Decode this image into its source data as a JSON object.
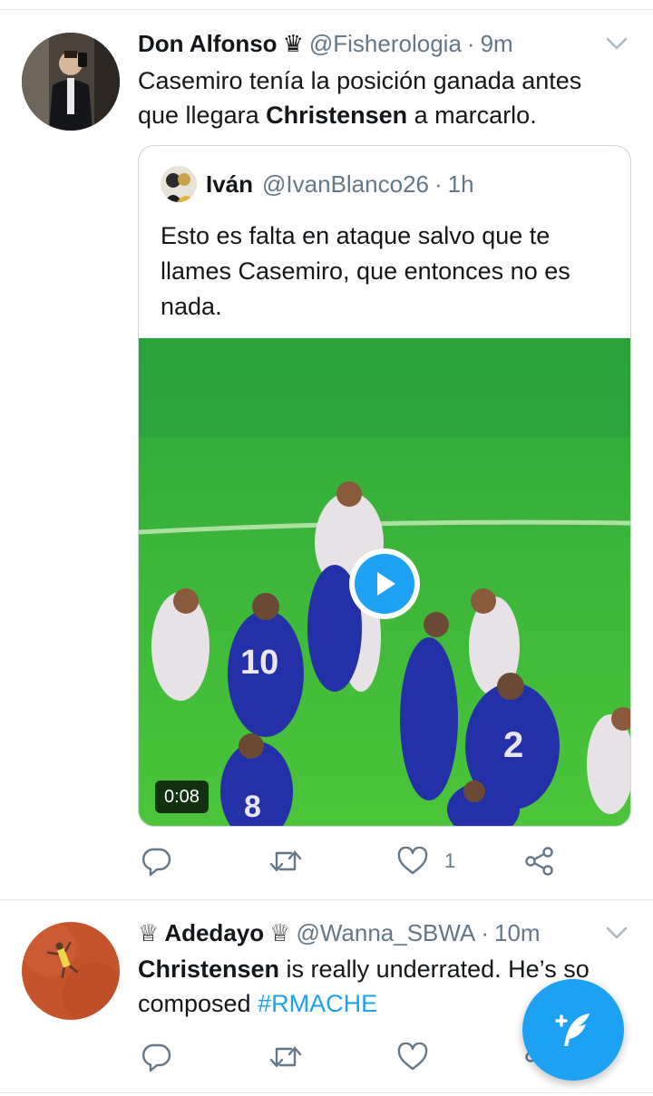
{
  "tweets": [
    {
      "name": "Don Alfonso",
      "crown_after": "♛",
      "handle": "@Fisherologia",
      "dot": "·",
      "time": "9m",
      "text_before": "Casemiro tenía la posición ganada antes que llegara ",
      "text_bold": "Christensen",
      "text_after": " a marcarlo.",
      "quote": {
        "name": "Iván",
        "handle": "@IvanBlanco26",
        "dot": "·",
        "time": "1h",
        "text": "Esto es falta en ataque salvo que te llames Casemiro, que entonces no es nada.",
        "video_duration": "0:08",
        "jerseys": [
          "10",
          "8",
          "2"
        ]
      },
      "actions": {
        "reply_count": "",
        "retweet_count": "",
        "like_count": "1"
      }
    },
    {
      "name_prefix": "♕",
      "name": "Adedayo",
      "name_suffix": "♕",
      "handle": "@Wanna_SBWA",
      "dot": "·",
      "time": "10m",
      "text_bold": "Christensen",
      "text_after": " is really underrated. He’s so composed ",
      "hashtag": "#RMACHE",
      "actions": {
        "reply_count": "",
        "retweet_count": "",
        "like_count": ""
      }
    }
  ],
  "icons": {
    "reply": "reply-icon",
    "retweet": "retweet-icon",
    "like": "heart-icon",
    "share": "share-icon",
    "compose": "compose-tweet-icon",
    "more": "chevron-down-icon",
    "play": "play-icon"
  },
  "colors": {
    "accent": "#1da1f2",
    "secondary_text": "#657786",
    "border": "#e1e8ed",
    "pitch": "#3fbf2e"
  }
}
